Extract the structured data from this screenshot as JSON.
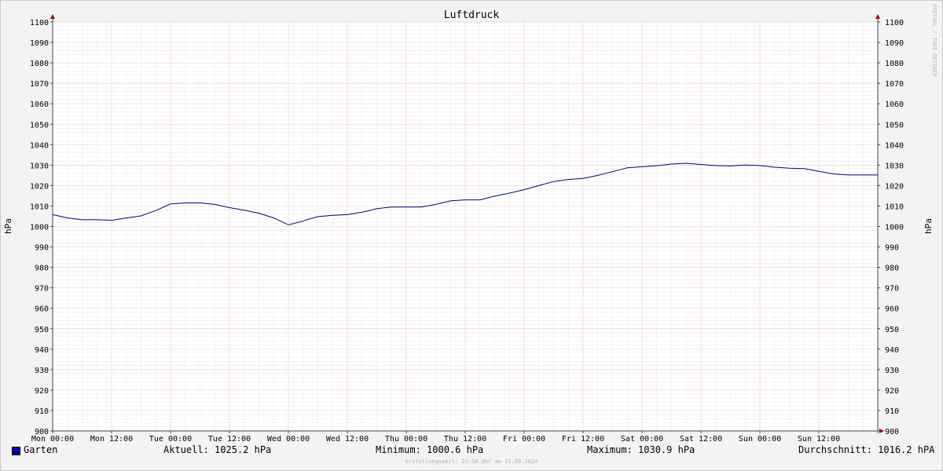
{
  "chart_data": {
    "type": "line",
    "title": "Luftdruck",
    "ylabel": "hPa",
    "ylabel_right": "hPa",
    "ylim": [
      900,
      1100
    ],
    "y_ticks": [
      900,
      910,
      920,
      930,
      940,
      950,
      960,
      970,
      980,
      990,
      1000,
      1010,
      1020,
      1030,
      1040,
      1050,
      1060,
      1070,
      1080,
      1090,
      1100
    ],
    "x_ticks": [
      "Mon 00:00",
      "Mon 12:00",
      "Tue 00:00",
      "Tue 12:00",
      "Wed 00:00",
      "Wed 12:00",
      "Thu 00:00",
      "Thu 12:00",
      "Fri 00:00",
      "Fri 12:00",
      "Sat 00:00",
      "Sat 12:00",
      "Sun 00:00",
      "Sun 12:00"
    ],
    "x_unit": "hours since Mon 00:00",
    "xlim": [
      0,
      168
    ],
    "grid": true,
    "series": [
      {
        "name": "Garten",
        "color": "#000080",
        "x": [
          0,
          3,
          6,
          9,
          12,
          15,
          18,
          21,
          24,
          27,
          30,
          33,
          36,
          39,
          42,
          45,
          48,
          50,
          51,
          52,
          54,
          57,
          60,
          63,
          64,
          66,
          69,
          72,
          75,
          78,
          81,
          84,
          87,
          90,
          93,
          96,
          99,
          102,
          105,
          108,
          111,
          114,
          117,
          120,
          123,
          126,
          129,
          132,
          135,
          138,
          141,
          144,
          147,
          150,
          153,
          156,
          159,
          162,
          165,
          168
        ],
        "values": [
          1005.8,
          1004.2,
          1003.3,
          1003.3,
          1003.0,
          1004.2,
          1005.2,
          1007.8,
          1011.0,
          1011.5,
          1011.5,
          1010.8,
          1009.2,
          1008.0,
          1006.5,
          1004.2,
          1000.8,
          1002.0,
          1002.6,
          1003.5,
          1004.8,
          1005.5,
          1005.8,
          1007.0,
          1007.5,
          1008.7,
          1009.5,
          1009.5,
          1009.5,
          1010.8,
          1012.5,
          1013.0,
          1013.0,
          1014.8,
          1016.3,
          1018.0,
          1020.0,
          1022.0,
          1023.0,
          1023.5,
          1025.0,
          1026.8,
          1028.7,
          1029.2,
          1029.7,
          1030.5,
          1030.9,
          1030.3,
          1029.8,
          1029.6,
          1030.0,
          1029.8,
          1029.0,
          1028.5,
          1028.3,
          1027.0,
          1025.7,
          1025.2,
          1025.2,
          1025.2
        ]
      }
    ],
    "legend": {
      "series_label": "Garten",
      "aktuell": "Aktuell: 1025.2 hPa",
      "minimum": "Minimum: 1000.6 hPa",
      "maximum": "Maximum: 1030.9 hPa",
      "durchschnitt": "Durchschnitt: 1016.2 hPA"
    },
    "watermark": "RRDTOOL / TOBI OETIKER",
    "footer": "Erstellungszeit: 23:58 Uhr am 15.09.2024"
  }
}
